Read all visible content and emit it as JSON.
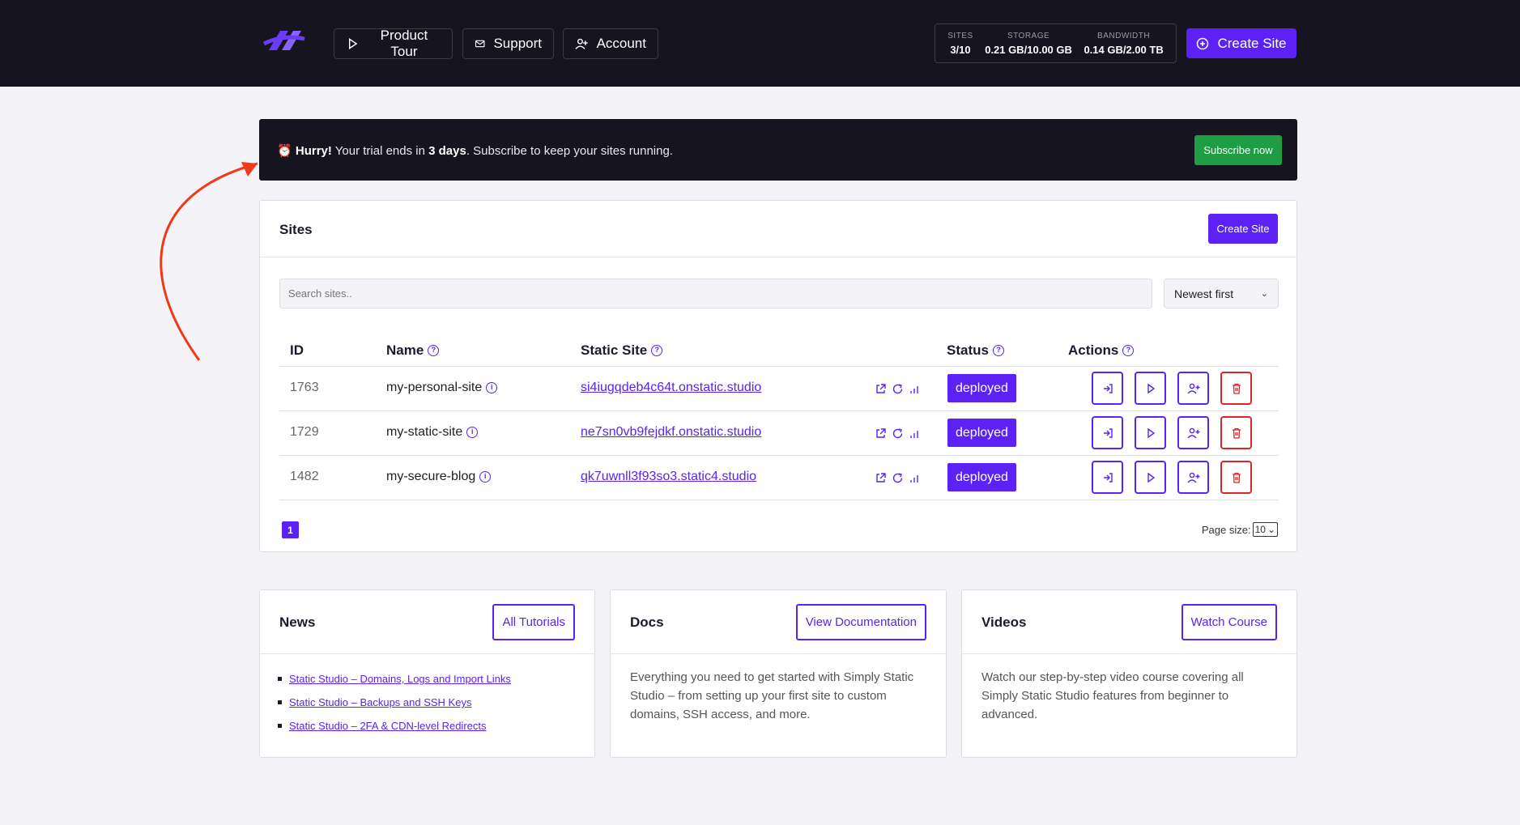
{
  "header": {
    "nav": [
      {
        "label": "Product Tour",
        "icon": "play-icon"
      },
      {
        "label": "Support",
        "icon": "mail-icon"
      },
      {
        "label": "Account",
        "icon": "user-plus-icon"
      }
    ],
    "stats": [
      {
        "label": "SITES",
        "value": "3/10"
      },
      {
        "label": "STORAGE",
        "value": "0.21 GB/10.00 GB"
      },
      {
        "label": "BANDWIDTH",
        "value": "0.14 GB/2.00 TB"
      }
    ],
    "create_label": "Create Site"
  },
  "banner": {
    "emoji": "⏰",
    "hurry": "Hurry!",
    "text_before": " Your trial ends in ",
    "days": "3 days",
    "text_after": ". Subscribe to keep your sites running.",
    "subscribe_label": "Subscribe now"
  },
  "sites": {
    "title": "Sites",
    "create_label": "Create Site",
    "search_placeholder": "Search sites..",
    "sort_value": "Newest first",
    "columns": {
      "id": "ID",
      "name": "Name",
      "static_site": "Static Site",
      "status": "Status",
      "actions": "Actions"
    },
    "rows": [
      {
        "id": "1763",
        "name": "my-personal-site",
        "site": "si4iugqdeb4c64t.onstatic.studio",
        "status": "deployed"
      },
      {
        "id": "1729",
        "name": "my-static-site",
        "site": "ne7sn0vb9fejdkf.onstatic.studio",
        "status": "deployed"
      },
      {
        "id": "1482",
        "name": "my-secure-blog",
        "site": "qk7uwnll3f93so3.static4.studio",
        "status": "deployed"
      }
    ],
    "page": "1",
    "page_size_label": "Page size:",
    "page_size_value": "10"
  },
  "news": {
    "title": "News",
    "button": "All Tutorials",
    "items": [
      "Static Studio – Domains, Logs and Import Links",
      "Static Studio – Backups and SSH Keys",
      "Static Studio – 2FA & CDN-level Redirects"
    ]
  },
  "docs": {
    "title": "Docs",
    "button": "View Documentation",
    "text": "Everything you need to get started with Simply Static Studio – from setting up your first site to custom domains, SSH access, and more."
  },
  "videos": {
    "title": "Videos",
    "button": "Watch Course",
    "text": "Watch our step-by-step video course covering all Simply Static Studio features from beginner to advanced."
  },
  "colors": {
    "accent": "#5b21f5",
    "header_bg": "#15141f",
    "success": "#1f9d45",
    "danger": "#d62828",
    "annotation": "#f03a17"
  }
}
